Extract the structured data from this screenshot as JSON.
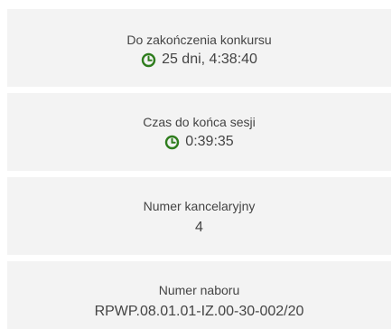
{
  "colors": {
    "panel_bg": "#f3f3f3",
    "text": "#444444",
    "clock": "#2f7d1e"
  },
  "panels": [
    {
      "label": "Do zakończenia konkursu",
      "value": "25 dni, 4:38:40",
      "icon": "clock-icon"
    },
    {
      "label": "Czas do końca sesji",
      "value": "0:39:35",
      "icon": "clock-icon"
    },
    {
      "label": "Numer kancelaryjny",
      "value": "4"
    },
    {
      "label": "Numer naboru",
      "value": "RPWP.08.01.01-IZ.00-30-002/20"
    }
  ]
}
